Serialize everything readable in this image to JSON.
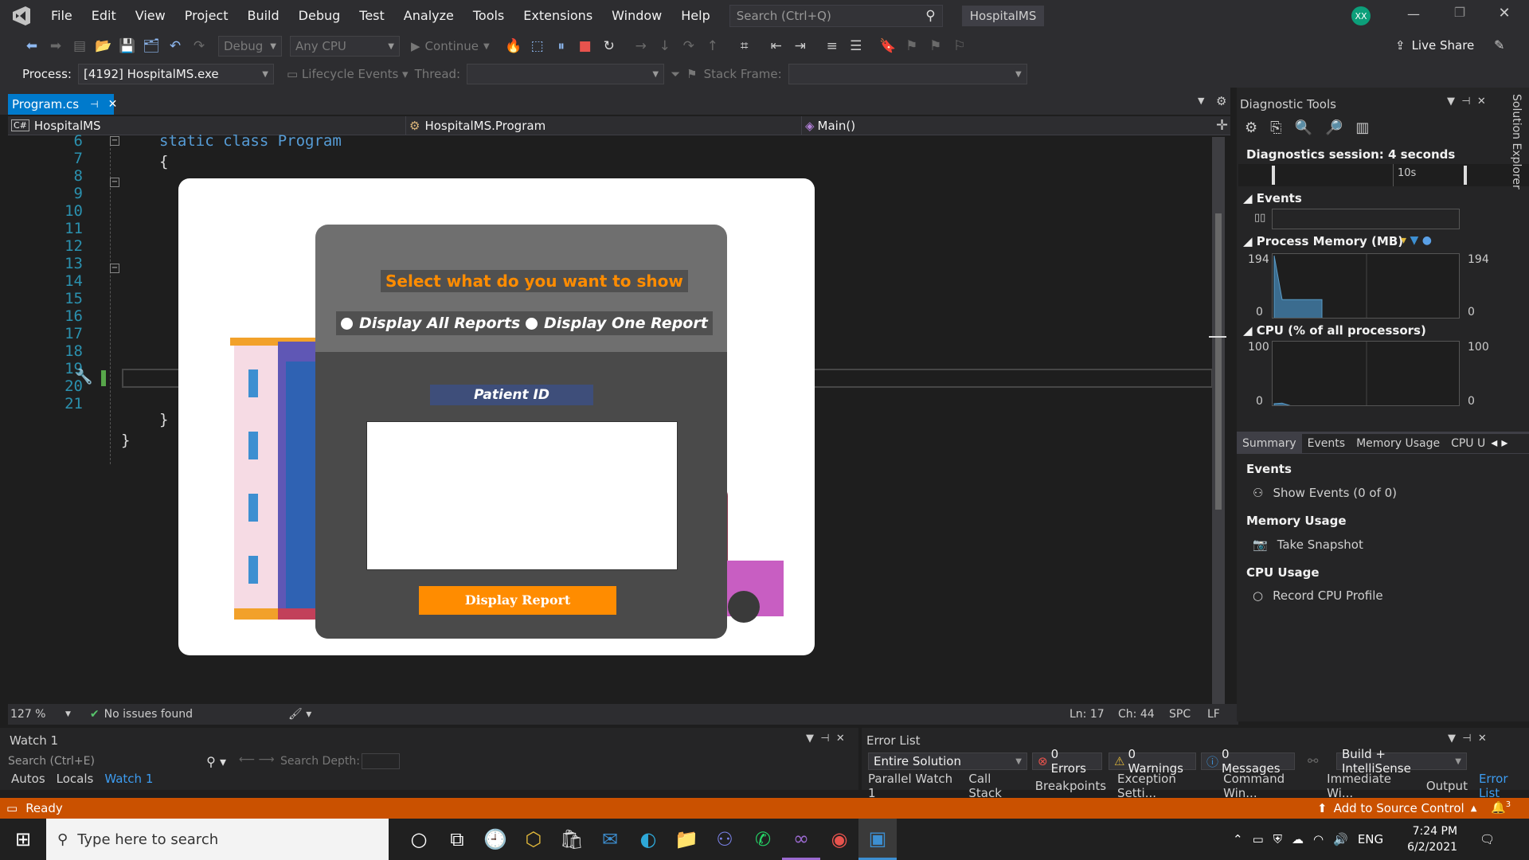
{
  "menu": {
    "items": [
      "File",
      "Edit",
      "View",
      "Project",
      "Build",
      "Debug",
      "Test",
      "Analyze",
      "Tools",
      "Extensions",
      "Window",
      "Help"
    ],
    "search_placeholder": "Search (Ctrl+Q)",
    "solution_name": "HospitalMS",
    "avatar": "XX",
    "live_share": "Live Share"
  },
  "toolbar": {
    "config": "Debug",
    "platform": "Any CPU",
    "continue": "Continue"
  },
  "processbar": {
    "process_label": "Process:",
    "process_value": "[4192] HospitalMS.exe",
    "lifecycle": "Lifecycle Events",
    "thread_label": "Thread:",
    "stackframe_label": "Stack Frame:"
  },
  "editor": {
    "tab_name": "Program.cs",
    "nav_project": "HospitalMS",
    "nav_class": "HospitalMS.Program",
    "nav_member": "Main()",
    "line_numbers": [
      "6",
      "7",
      "8",
      "9",
      "10",
      "11",
      "12",
      "13",
      "14",
      "15",
      "16",
      "17",
      "18",
      "19",
      "20",
      "21"
    ],
    "code_line_6": "static class Program",
    "code_brace_open": "{",
    "code_brace_close_inner": "}",
    "code_brace_close_outer": "}",
    "zoom": "127 %",
    "issues": "No issues found",
    "ln": "Ln: 17",
    "ch": "Ch: 44",
    "spc": "SPC",
    "lf": "LF"
  },
  "app_dialog": {
    "heading": "Select what do you want to show",
    "radio_all": "Display All Reports",
    "radio_one": "Display One Report",
    "patient_id_label": "Patient ID",
    "button": "Display Report"
  },
  "diagnostics": {
    "title": "Diagnostic Tools",
    "session": "Diagnostics session: 4 seconds",
    "timeline_tick": "10s",
    "events_header": "Events",
    "memory_header": "Process Memory (MB)",
    "memory_max": "194",
    "memory_min": "0",
    "cpu_header": "CPU (% of all processors)",
    "cpu_max": "100",
    "cpu_min": "0",
    "tabs": [
      "Summary",
      "Events",
      "Memory Usage",
      "CPU U"
    ],
    "sec_events": "Events",
    "show_events": "Show Events (0 of 0)",
    "sec_memory": "Memory Usage",
    "take_snapshot": "Take Snapshot",
    "sec_cpu": "CPU Usage",
    "record_cpu": "Record CPU Profile",
    "solution_explorer": "Solution Explorer"
  },
  "watch": {
    "title": "Watch 1",
    "search_placeholder": "Search (Ctrl+E)",
    "search_depth": "Search Depth:",
    "tabs": [
      "Autos",
      "Locals",
      "Watch 1"
    ]
  },
  "errorlist": {
    "title": "Error List",
    "scope": "Entire Solution",
    "errors": "0 Errors",
    "warnings": "0 Warnings",
    "messages": "0 Messages",
    "build": "Build + IntelliSense",
    "tabs": [
      "Parallel Watch 1",
      "Call Stack",
      "Breakpoints",
      "Exception Setti...",
      "Command Win...",
      "Immediate Wi...",
      "Output",
      "Error List"
    ]
  },
  "statusbar": {
    "ready": "Ready",
    "source_control": "Add to Source Control",
    "notifications": "3"
  },
  "taskbar": {
    "search_placeholder": "Type here to search",
    "lang": "ENG",
    "time": "7:24 PM",
    "date": "6/2/2021"
  },
  "colors": {
    "accent": "#007acc",
    "status_orange": "#ca5100",
    "dialog_orange": "#ff8c00",
    "patient_bar": "#3e4e7a"
  },
  "chart_data": [
    {
      "type": "area",
      "title": "Process Memory (MB)",
      "ylim": [
        0,
        194
      ],
      "values": [
        194,
        60,
        60,
        60,
        60,
        60,
        60
      ]
    },
    {
      "type": "area",
      "title": "CPU (% of all processors)",
      "ylim": [
        0,
        100
      ],
      "values": [
        5,
        6,
        2,
        1,
        1,
        1,
        1
      ]
    }
  ]
}
